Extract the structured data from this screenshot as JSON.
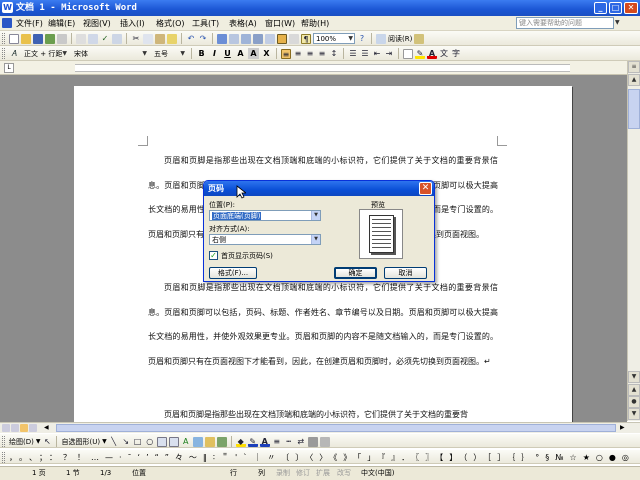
{
  "window": {
    "title": "文档 1 - Microsoft Word",
    "icon": "W"
  },
  "menu": {
    "items": [
      "文件(F)",
      "编辑(E)",
      "视图(V)",
      "插入(I)",
      "格式(O)",
      "工具(T)",
      "表格(A)",
      "窗口(W)",
      "帮助(H)"
    ],
    "help_placeholder": "键入需要帮助的问题"
  },
  "toolbar_standard": {
    "zoom": "100%",
    "read_label": "阅读(R)"
  },
  "toolbar_format": {
    "style": "正文 + 行距",
    "font": "宋体",
    "size": "五号"
  },
  "document": {
    "paragraphs": [
      "页眉和页脚是指那些出现在文档顶端和底端的小标识符，它们提供了关于文档的重要背景信息。页眉和页脚可以包括，页码、标题、作者姓名、章节编号以及日期。页眉和页脚可以极大提高长文档的易用性，并使外观效果更专业。页眉和页脚的内容不是随文档输入的，而是专门设置的。页眉和页脚只有在页面视图下才能看到，因此，在创建页眉和页脚时，必须先切换到页面视图。",
      "页眉和页脚是指那些出现在文档顶端和底端的小标识符，它们提供了关于文档的重要背景信息。页眉和页脚可以包括，页码、标题、作者姓名、章节编号以及日期。页眉和页脚可以极大提高长文档的易用性，并使外观效果更专业。页眉和页脚的内容不是随文档输入的，而是专门设置的。页眉和页脚只有在页面视图下才能看到，因此，在创建页眉和页脚时，必须先切换到页面视图。↵",
      "页眉和页脚是指那些出现在文档顶端和底端的小标识符，它们提供了关于文档的重要背"
    ]
  },
  "dialog": {
    "title": "页码",
    "position_label": "位置(P):",
    "position_value": "页面底端(页脚)",
    "alignment_label": "对齐方式(A):",
    "alignment_value": "右侧",
    "first_page_label": "首页显示页码(S)",
    "first_page_checked": true,
    "preview_label": "预览",
    "format_button": "格式(F)...",
    "ok_button": "确定",
    "cancel_button": "取消"
  },
  "drawing_toolbar": {
    "draw_label": "绘图(D)",
    "autoshape_label": "自选图形(U)"
  },
  "status": {
    "page": "1 页",
    "section": "1 节",
    "page_count": "1/3",
    "position": "位置",
    "line": "行",
    "column": "列",
    "modes": [
      "录制",
      "修订",
      "扩展",
      "改写"
    ],
    "language": "中文(中国)"
  },
  "colors": {
    "titlebar": "#1b56d4",
    "dialog_title": "#0a4fd6",
    "selection": "#316ac5",
    "workspace": "#8c8c8c"
  }
}
